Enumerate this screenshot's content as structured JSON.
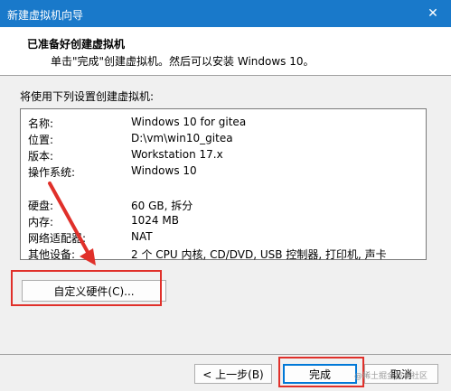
{
  "window": {
    "title": "新建虚拟机向导",
    "close_glyph": "✕"
  },
  "header": {
    "heading": "已准备好创建虚拟机",
    "subtext": "单击\"完成\"创建虚拟机。然后可以安装 Windows 10。"
  },
  "intro": "将使用下列设置创建虚拟机:",
  "settings": [
    {
      "key": "名称:",
      "value": "Windows 10 for gitea"
    },
    {
      "key": "位置:",
      "value": "D:\\vm\\win10_gitea"
    },
    {
      "key": "版本:",
      "value": "Workstation 17.x"
    },
    {
      "key": "操作系统:",
      "value": "Windows 10"
    },
    {
      "key": "硬盘:",
      "value": "60 GB, 拆分"
    },
    {
      "key": "内存:",
      "value": "1024 MB"
    },
    {
      "key": "网络适配器:",
      "value": "NAT"
    },
    {
      "key": "其他设备:",
      "value": "2 个 CPU 内核, CD/DVD, USB 控制器, 打印机, 声卡"
    }
  ],
  "buttons": {
    "customize": "自定义硬件(C)...",
    "back": "< 上一步(B)",
    "finish": "完成",
    "cancel": "取消"
  },
  "watermark": "@稀土掘金技术社区",
  "colors": {
    "titlebar": "#1979ca",
    "highlight": "#e0302a",
    "accent": "#0078d7"
  }
}
